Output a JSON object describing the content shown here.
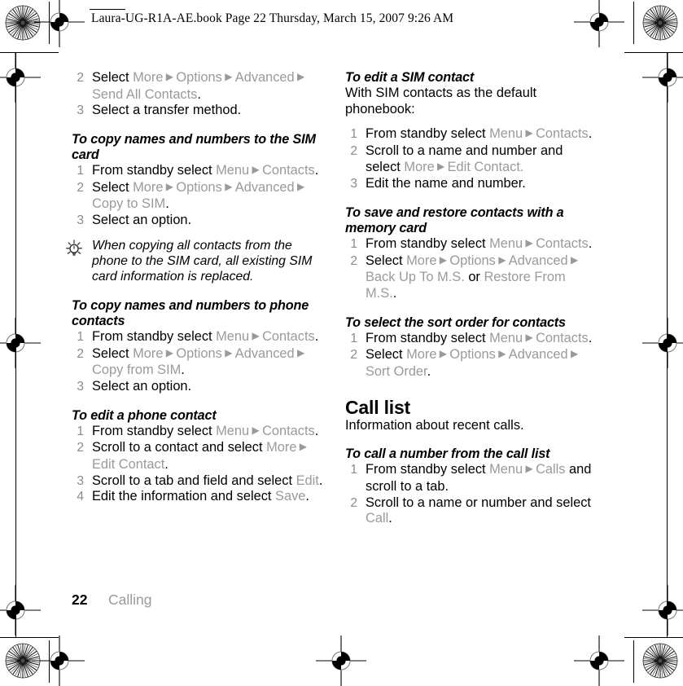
{
  "header": {
    "text": "Laura-UG-R1A-AE.book  Page 22  Thursday, March 15, 2007  9:26 AM"
  },
  "footer": {
    "page_number": "22",
    "chapter": "Calling"
  },
  "icons": {
    "tip": "lightbulb-icon",
    "registration_star": "registration-star-icon",
    "registration_cross": "registration-crosshair-icon"
  },
  "colors": {
    "text": "#000000",
    "ui_label": "#9a9a9a",
    "step_number": "#8b8b8b",
    "page": "#ffffff"
  },
  "left_column": {
    "continued_steps": [
      {
        "num": "2",
        "runs": [
          {
            "t": "Select ",
            "s": "black"
          },
          {
            "t": "More",
            "s": "ui"
          },
          {
            "t": " ▶ ",
            "s": "arrow"
          },
          {
            "t": "Options",
            "s": "ui"
          },
          {
            "t": " ▶ ",
            "s": "arrow"
          },
          {
            "t": "Advanced",
            "s": "ui"
          },
          {
            "t": " ▶ ",
            "s": "arrow"
          },
          {
            "t": "Send All Contacts",
            "s": "ui"
          },
          {
            "t": ".",
            "s": "black"
          }
        ]
      },
      {
        "num": "3",
        "runs": [
          {
            "t": "Select a transfer method.",
            "s": "black"
          }
        ]
      }
    ],
    "sections": [
      {
        "heading": "To copy names and numbers to the SIM card",
        "steps": [
          {
            "num": "1",
            "runs": [
              {
                "t": "From standby select ",
                "s": "black"
              },
              {
                "t": "Menu",
                "s": "ui"
              },
              {
                "t": " ▶ ",
                "s": "arrow"
              },
              {
                "t": "Contacts",
                "s": "ui"
              },
              {
                "t": ".",
                "s": "black"
              }
            ]
          },
          {
            "num": "2",
            "runs": [
              {
                "t": "Select ",
                "s": "black"
              },
              {
                "t": "More",
                "s": "ui"
              },
              {
                "t": " ▶ ",
                "s": "arrow"
              },
              {
                "t": "Options",
                "s": "ui"
              },
              {
                "t": " ▶ ",
                "s": "arrow"
              },
              {
                "t": "Advanced",
                "s": "ui"
              },
              {
                "t": " ▶ ",
                "s": "arrow"
              },
              {
                "t": "Copy to SIM",
                "s": "ui"
              },
              {
                "t": ".",
                "s": "black"
              }
            ]
          },
          {
            "num": "3",
            "runs": [
              {
                "t": "Select an option.",
                "s": "black"
              }
            ]
          }
        ]
      },
      {
        "heading": "To copy names and numbers to phone contacts",
        "steps": [
          {
            "num": "1",
            "runs": [
              {
                "t": "From standby select ",
                "s": "black"
              },
              {
                "t": "Menu",
                "s": "ui"
              },
              {
                "t": " ▶ ",
                "s": "arrow"
              },
              {
                "t": "Contacts",
                "s": "ui"
              },
              {
                "t": ".",
                "s": "black"
              }
            ]
          },
          {
            "num": "2",
            "runs": [
              {
                "t": "Select ",
                "s": "black"
              },
              {
                "t": "More",
                "s": "ui"
              },
              {
                "t": " ▶ ",
                "s": "arrow"
              },
              {
                "t": "Options",
                "s": "ui"
              },
              {
                "t": " ▶ ",
                "s": "arrow"
              },
              {
                "t": "Advanced",
                "s": "ui"
              },
              {
                "t": " ▶ ",
                "s": "arrow"
              },
              {
                "t": "Copy from SIM",
                "s": "ui"
              },
              {
                "t": ".",
                "s": "black"
              }
            ]
          },
          {
            "num": "3",
            "runs": [
              {
                "t": "Select an option.",
                "s": "black"
              }
            ]
          }
        ]
      },
      {
        "heading": "To edit a phone contact",
        "steps": [
          {
            "num": "1",
            "runs": [
              {
                "t": "From standby select ",
                "s": "black"
              },
              {
                "t": "Menu",
                "s": "ui"
              },
              {
                "t": " ▶ ",
                "s": "arrow"
              },
              {
                "t": "Contacts",
                "s": "ui"
              },
              {
                "t": ".",
                "s": "black"
              }
            ]
          },
          {
            "num": "2",
            "runs": [
              {
                "t": "Scroll to a contact and select ",
                "s": "black"
              },
              {
                "t": "More",
                "s": "ui"
              },
              {
                "t": " ▶ ",
                "s": "arrow"
              },
              {
                "t": "Edit Contact",
                "s": "ui"
              },
              {
                "t": ".",
                "s": "black"
              }
            ]
          },
          {
            "num": "3",
            "runs": [
              {
                "t": "Scroll to a tab and field and select ",
                "s": "black"
              },
              {
                "t": "Edit",
                "s": "ui"
              },
              {
                "t": ".",
                "s": "black"
              }
            ]
          },
          {
            "num": "4",
            "runs": [
              {
                "t": "Edit the information and select ",
                "s": "black"
              },
              {
                "t": "Save",
                "s": "ui"
              },
              {
                "t": ".",
                "s": "black"
              }
            ]
          }
        ]
      }
    ],
    "tip": {
      "icon": "lightbulb-icon",
      "text": "When copying all contacts from the phone to the SIM card, all existing SIM card information is replaced."
    }
  },
  "right_column": {
    "sections": [
      {
        "heading": "To edit a SIM contact",
        "intro": "With SIM contacts as the default phonebook:",
        "steps": [
          {
            "num": "1",
            "runs": [
              {
                "t": "From standby select ",
                "s": "black"
              },
              {
                "t": "Menu",
                "s": "ui"
              },
              {
                "t": " ▶ ",
                "s": "arrow"
              },
              {
                "t": "Contacts",
                "s": "ui"
              },
              {
                "t": ".",
                "s": "black"
              }
            ]
          },
          {
            "num": "2",
            "runs": [
              {
                "t": "Scroll to a name and number and select ",
                "s": "black"
              },
              {
                "t": "More",
                "s": "ui"
              },
              {
                "t": " ▶ ",
                "s": "arrow"
              },
              {
                "t": "Edit Contact.",
                "s": "ui"
              }
            ]
          },
          {
            "num": "3",
            "runs": [
              {
                "t": "Edit the name and number.",
                "s": "black"
              }
            ]
          }
        ]
      },
      {
        "heading": "To save and restore contacts with a memory card",
        "steps": [
          {
            "num": "1",
            "runs": [
              {
                "t": "From standby select ",
                "s": "black"
              },
              {
                "t": "Menu",
                "s": "ui"
              },
              {
                "t": " ▶ ",
                "s": "arrow"
              },
              {
                "t": "Contacts",
                "s": "ui"
              },
              {
                "t": ".",
                "s": "black"
              }
            ]
          },
          {
            "num": "2",
            "runs": [
              {
                "t": "Select ",
                "s": "black"
              },
              {
                "t": "More",
                "s": "ui"
              },
              {
                "t": " ▶ ",
                "s": "arrow"
              },
              {
                "t": "Options",
                "s": "ui"
              },
              {
                "t": " ▶ ",
                "s": "arrow"
              },
              {
                "t": "Advanced",
                "s": "ui"
              },
              {
                "t": " ▶ ",
                "s": "arrow"
              },
              {
                "t": "Back Up To M.S.",
                "s": "ui"
              },
              {
                "t": " or ",
                "s": "black"
              },
              {
                "t": "Restore From M.S.",
                "s": "ui"
              },
              {
                "t": ".",
                "s": "black"
              }
            ]
          }
        ]
      },
      {
        "heading": "To select the sort order for contacts",
        "steps": [
          {
            "num": "1",
            "runs": [
              {
                "t": "From standby select ",
                "s": "black"
              },
              {
                "t": "Menu",
                "s": "ui"
              },
              {
                "t": " ▶ ",
                "s": "arrow"
              },
              {
                "t": "Contacts",
                "s": "ui"
              },
              {
                "t": ".",
                "s": "black"
              }
            ]
          },
          {
            "num": "2",
            "runs": [
              {
                "t": "Select ",
                "s": "black"
              },
              {
                "t": "More",
                "s": "ui"
              },
              {
                "t": " ▶ ",
                "s": "arrow"
              },
              {
                "t": "Options",
                "s": "ui"
              },
              {
                "t": " ▶ ",
                "s": "arrow"
              },
              {
                "t": "Advanced",
                "s": "ui"
              },
              {
                "t": " ▶ ",
                "s": "arrow"
              },
              {
                "t": "Sort Order",
                "s": "ui"
              },
              {
                "t": ".",
                "s": "black"
              }
            ]
          }
        ]
      }
    ],
    "call_list": {
      "heading": "Call list",
      "intro": "Information about recent calls.",
      "sections": [
        {
          "heading": "To call a number from the call list",
          "steps": [
            {
              "num": "1",
              "runs": [
                {
                  "t": "From standby select ",
                  "s": "black"
                },
                {
                  "t": "Menu",
                  "s": "ui"
                },
                {
                  "t": " ▶ ",
                  "s": "arrow"
                },
                {
                  "t": "Calls",
                  "s": "ui"
                },
                {
                  "t": " and scroll to a tab.",
                  "s": "black"
                }
              ]
            },
            {
              "num": "2",
              "runs": [
                {
                  "t": "Scroll to a name or number and select ",
                  "s": "black"
                },
                {
                  "t": "Call",
                  "s": "ui"
                },
                {
                  "t": ".",
                  "s": "black"
                }
              ]
            }
          ]
        }
      ]
    }
  }
}
